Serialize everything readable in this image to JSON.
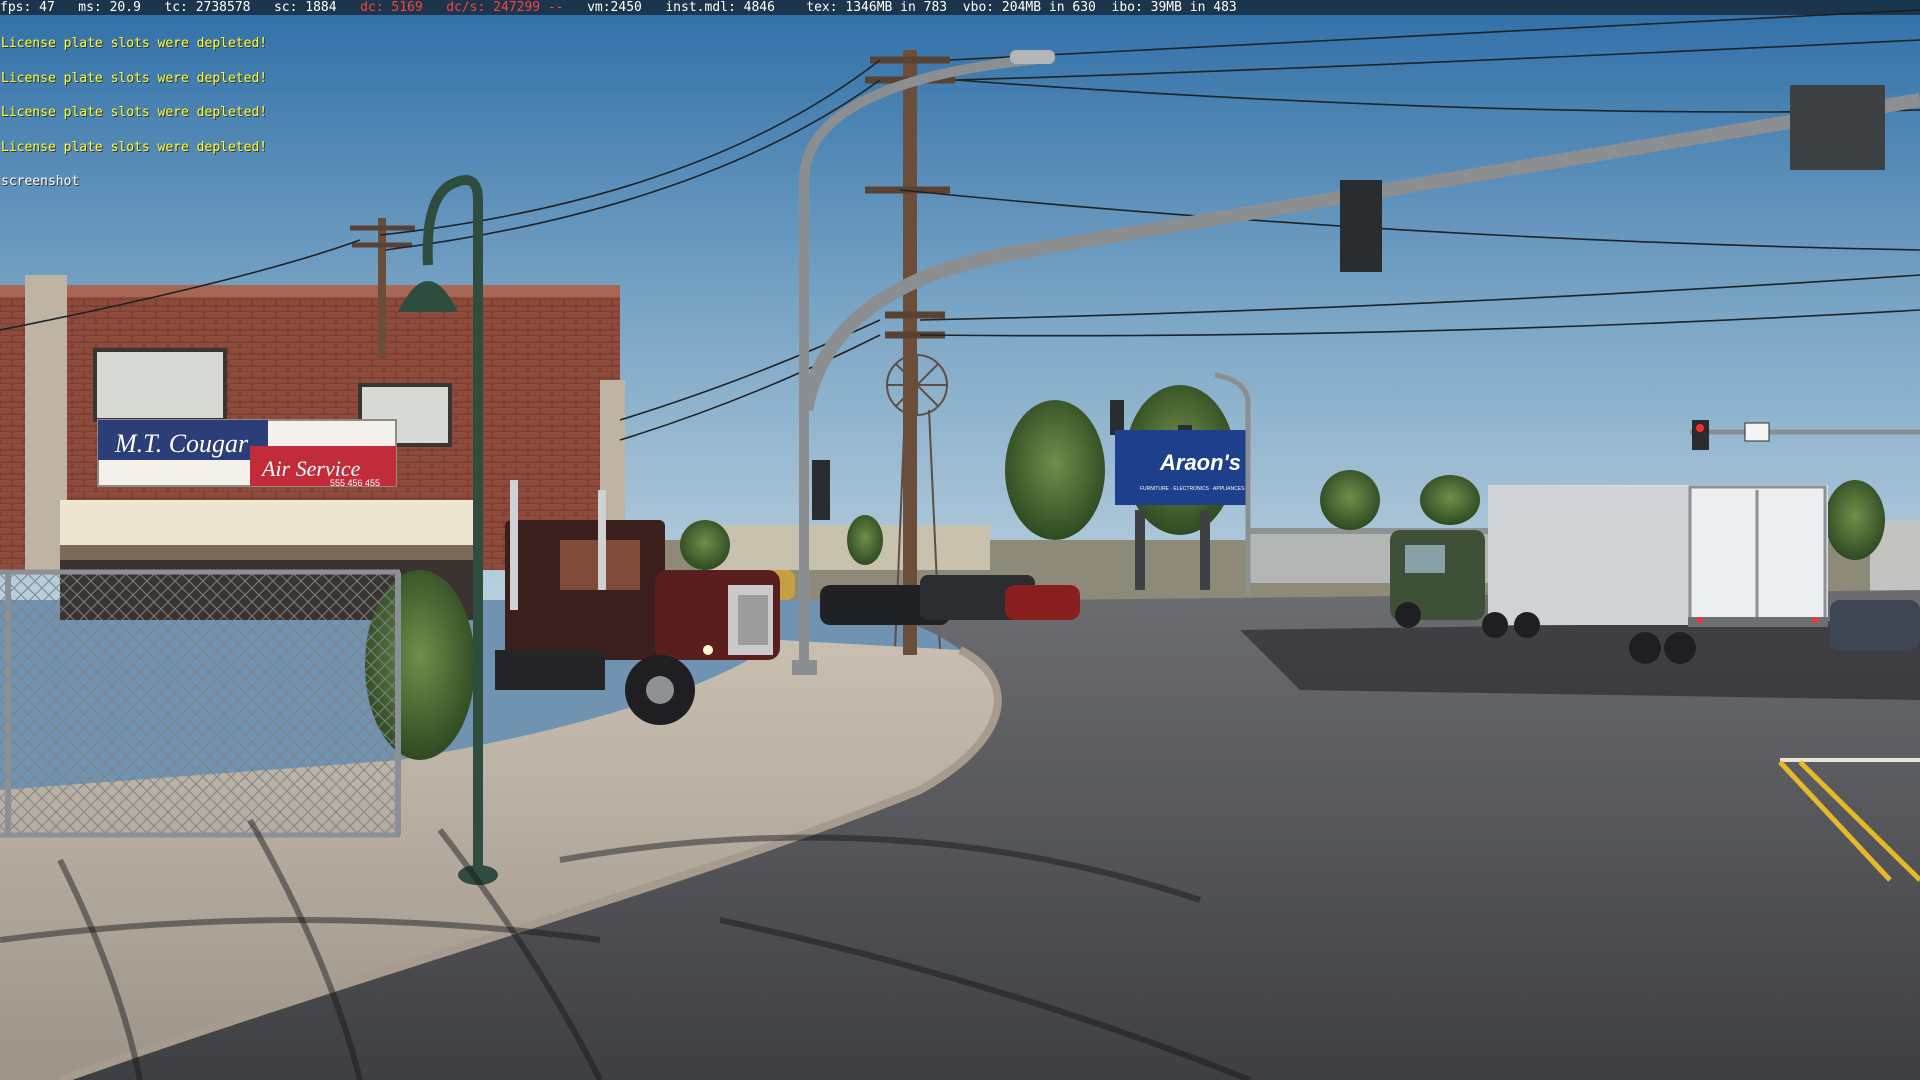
{
  "debug": {
    "fps": "fps: 47",
    "ms": "ms: 20.9",
    "tc": "tc: 2738578",
    "sc": "sc: 1884",
    "dc": "dc: 5169",
    "dcs": "dc/s: 247299 --",
    "vm": "vm:2450",
    "inst": "inst.mdl: 4846",
    "tex": "tex: 1346MB in 783",
    "vbo": "vbo: 204MB in 630",
    "ibo": "ibo: 39MB in 483",
    "warn_color": "#ff4040"
  },
  "console": {
    "lines": [
      "License plate slots were depleted!",
      "License plate slots were depleted!",
      "License plate slots were depleted!",
      "License plate slots were depleted!"
    ],
    "command": "screenshot"
  },
  "scene": {
    "storefront_sign_line1": "M.T. Cougar",
    "storefront_sign_line2": "Air Service",
    "storefront_sign_phone": "555 456 455",
    "billboard_text": "Araon's",
    "billboard_subtext": "FURNITURE · ELECTRONICS · APPLIANCES",
    "colors": {
      "sky_top": "#2f6fa8",
      "sky_bottom": "#a9c3d6",
      "brick": "#8e4a3a",
      "road": "#4a4b4e",
      "sign_red": "#c22c3a",
      "billboard_blue": "#1d3f8c",
      "lane_yellow": "#e6b92a"
    }
  }
}
